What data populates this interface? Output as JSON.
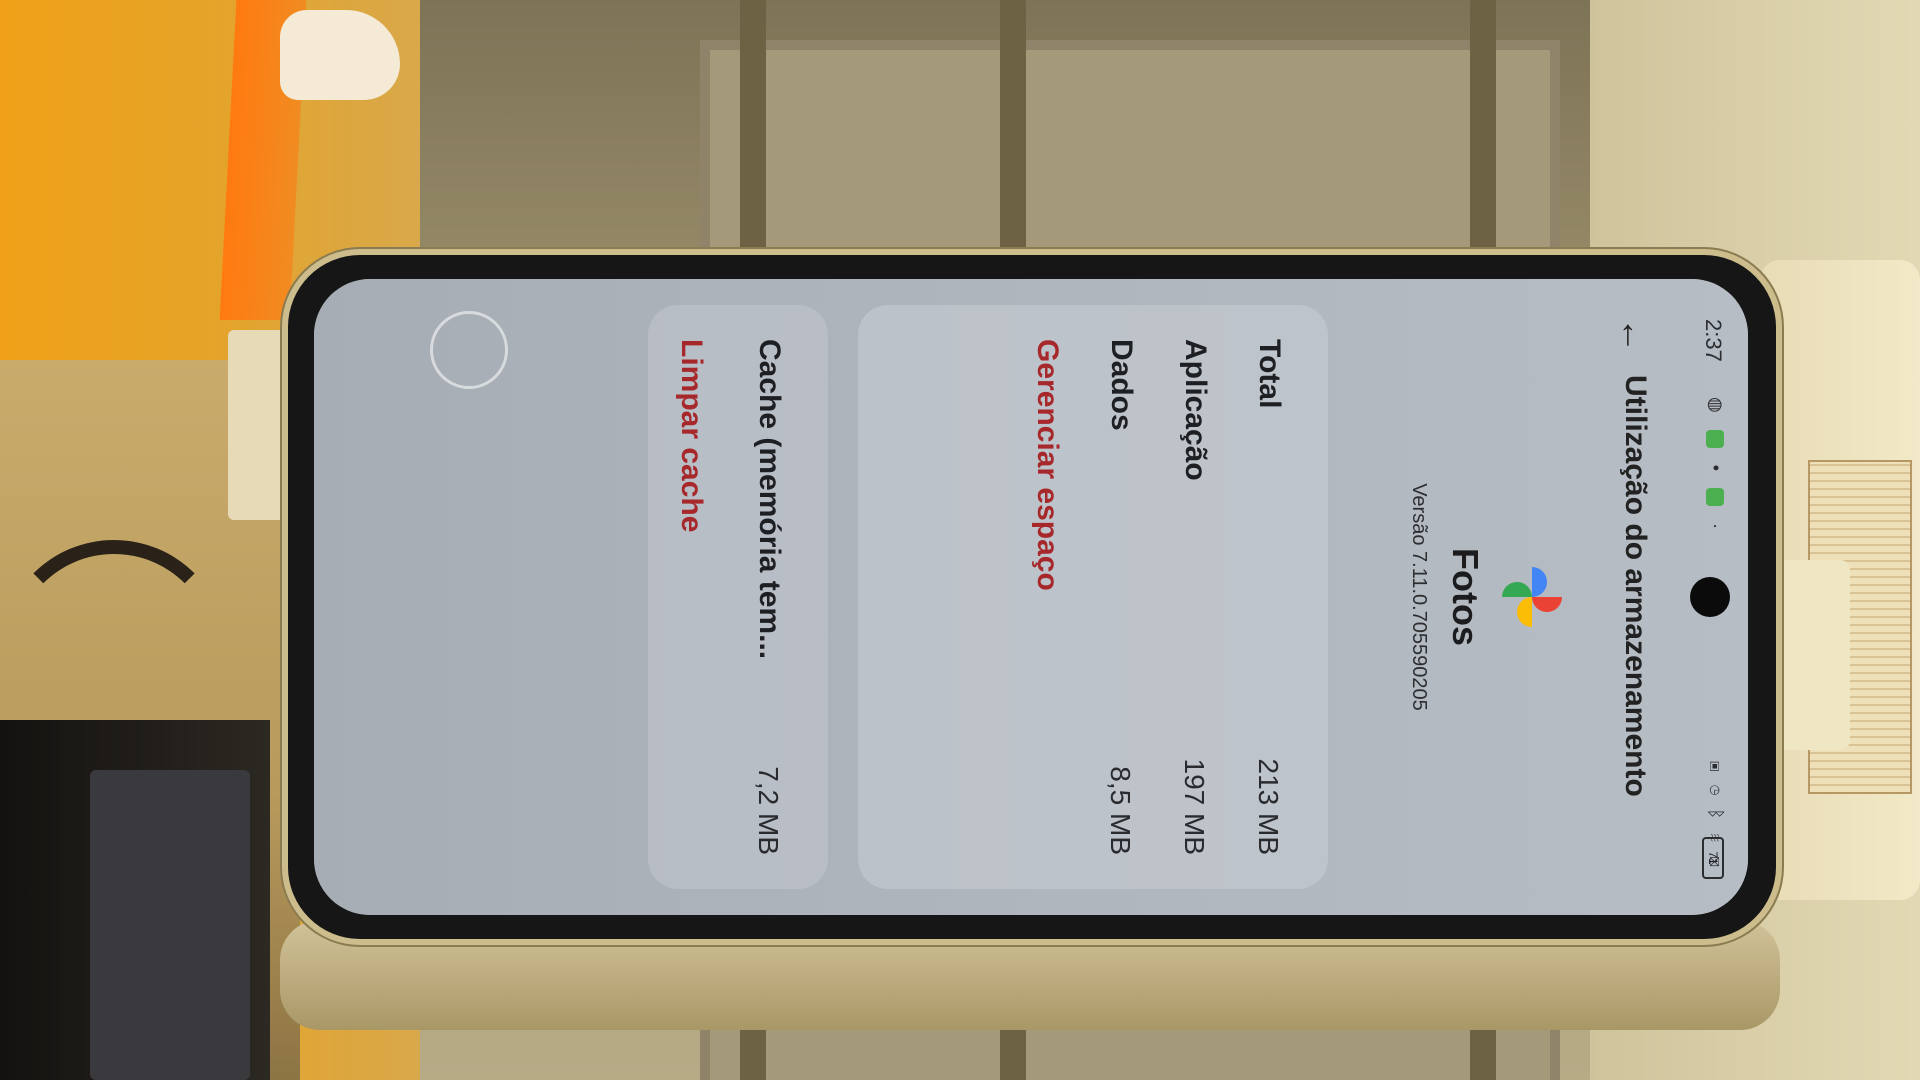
{
  "status_bar": {
    "time": "2:37",
    "battery": "71"
  },
  "title_bar": {
    "back_label": "←",
    "title": "Utilização do armazenamento"
  },
  "app": {
    "name": "Fotos",
    "version": "Versão 7.11.0.705590205",
    "icon": "google-photos-pinwheel-icon"
  },
  "storage": {
    "total_label": "Total",
    "total_value": "213 MB",
    "app_label": "Aplicação",
    "app_value": "197 MB",
    "data_label": "Dados",
    "data_value": "8,5 MB",
    "manage_label": "Gerenciar espaço"
  },
  "cache": {
    "label": "Cache (memória tem...",
    "value": "7,2 MB",
    "clear_label": "Limpar cache"
  },
  "colors": {
    "action_red": "#a6282b",
    "photos_blue": "#4285f4",
    "photos_red": "#ea4335",
    "photos_yellow": "#fbbc05",
    "photos_green": "#34a853"
  }
}
